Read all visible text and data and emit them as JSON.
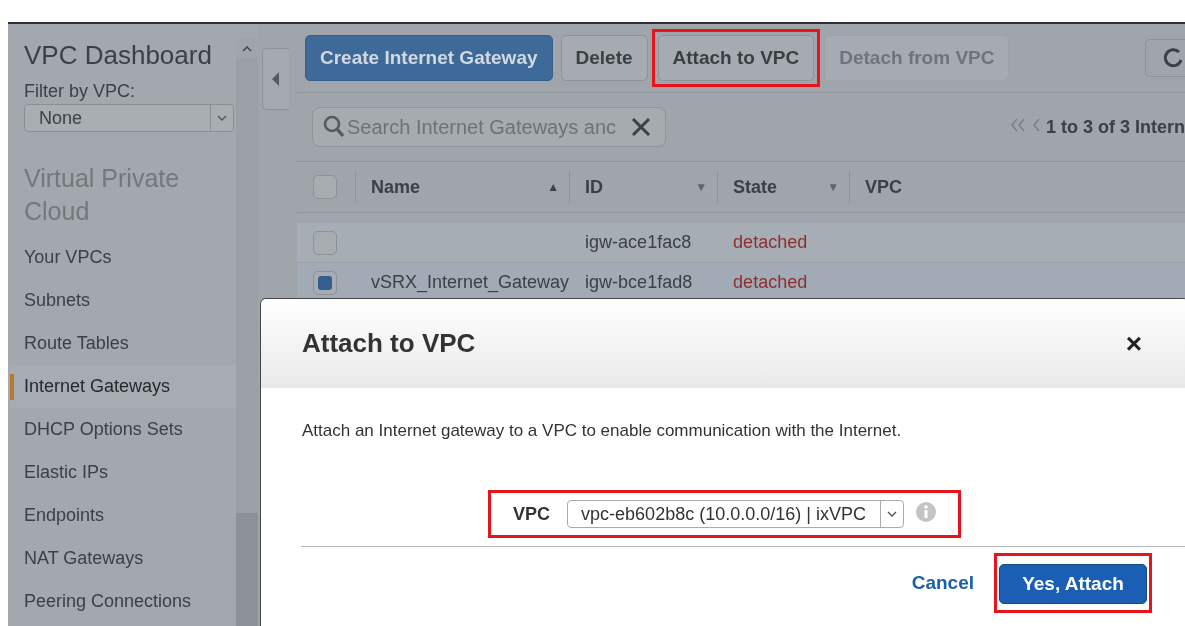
{
  "sidebar": {
    "title": "VPC Dashboard",
    "filter_label": "Filter by VPC:",
    "filter_value": "None",
    "section": "Virtual Private Cloud",
    "items": [
      {
        "label": "Your VPCs",
        "selected": false
      },
      {
        "label": "Subnets",
        "selected": false
      },
      {
        "label": "Route Tables",
        "selected": false
      },
      {
        "label": "Internet Gateways",
        "selected": true
      },
      {
        "label": "DHCP Options Sets",
        "selected": false
      },
      {
        "label": "Elastic IPs",
        "selected": false
      },
      {
        "label": "Endpoints",
        "selected": false
      },
      {
        "label": "NAT Gateways",
        "selected": false
      },
      {
        "label": "Peering Connections",
        "selected": false
      }
    ]
  },
  "toolbar": {
    "buttons": [
      {
        "label": "Create Internet Gateway",
        "kind": "primary",
        "disabled": false,
        "highlighted": false
      },
      {
        "label": "Delete",
        "kind": "default",
        "disabled": false,
        "highlighted": false
      },
      {
        "label": "Attach to VPC",
        "kind": "default",
        "disabled": false,
        "highlighted": true
      },
      {
        "label": "Detach from VPC",
        "kind": "default",
        "disabled": true,
        "highlighted": false
      }
    ]
  },
  "search": {
    "placeholder": "Search Internet Gateways anc"
  },
  "pagination": "1 to 3 of 3 Intern",
  "table": {
    "all_checked": false,
    "columns": [
      {
        "label": "Name",
        "sort_icon": "▲",
        "sorted": true
      },
      {
        "label": "ID",
        "sort_icon": "▼",
        "sorted": false
      },
      {
        "label": "State",
        "sort_icon": "▼",
        "sorted": false
      },
      {
        "label": "VPC"
      }
    ],
    "rows": [
      {
        "checked": false,
        "cells": [
          "",
          "igw-ace1fac8",
          "detached",
          ""
        ]
      },
      {
        "checked": true,
        "cells": [
          "vSRX_Internet_Gateway",
          "igw-bce1fad8",
          "detached",
          ""
        ]
      }
    ]
  },
  "dialog": {
    "title": "Attach to VPC",
    "close": "×",
    "description": "Attach an Internet gateway to a VPC to enable communication with the Internet.",
    "field_label": "VPC",
    "field_value": "vpc-eb602b8c (10.0.0.0/16) | ixVPC",
    "field_highlighted": true,
    "buttons": [
      {
        "label": "Cancel",
        "kind": "link",
        "highlighted": false
      },
      {
        "label": "Yes, Attach",
        "kind": "primary",
        "highlighted": true
      }
    ]
  }
}
